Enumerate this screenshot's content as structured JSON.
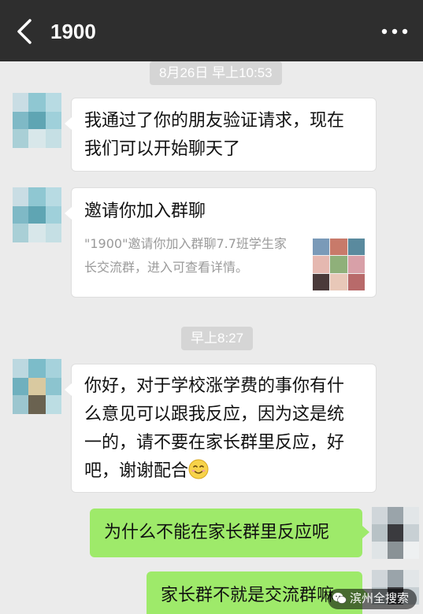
{
  "header": {
    "title": "1900",
    "back_icon": "chevron-left-icon",
    "more_icon": "more-dots-icon",
    "background": "#2e2e2e"
  },
  "messages": [
    {
      "type": "timestamp",
      "text": "8月26日 早上10:53"
    },
    {
      "type": "incoming",
      "lines": [
        "我通过了你的朋友验证请求，现在",
        "我们可以开始聊天了"
      ]
    },
    {
      "type": "incoming-invite",
      "title": "邀请你加入群聊",
      "desc_lines": [
        "\"1900\"邀请你加入群聊7.7班学生家",
        "长交流群，进入可查看详情。"
      ]
    },
    {
      "type": "timestamp",
      "text": "早上8:27"
    },
    {
      "type": "incoming",
      "lines": [
        "你好，对于学校涨学费的事你有什",
        "么意见可以跟我反应，因为这是统",
        "一的，请不要在家长群里反应，好",
        "吧，谢谢配合"
      ],
      "trailing_emoji": "smiling-emoji-icon"
    },
    {
      "type": "outgoing",
      "text": "为什么不能在家长群里反应呢"
    },
    {
      "type": "outgoing",
      "text": "家长群不就是交流群嘛"
    }
  ],
  "watermark": {
    "text": "滨州全搜索",
    "icon": "wechat-icon"
  },
  "colors": {
    "chat_bg": "#ebebeb",
    "outgoing_bubble": "#9eea6a",
    "incoming_bubble": "#ffffff",
    "timestamp_bg": "#d5d5d5"
  }
}
